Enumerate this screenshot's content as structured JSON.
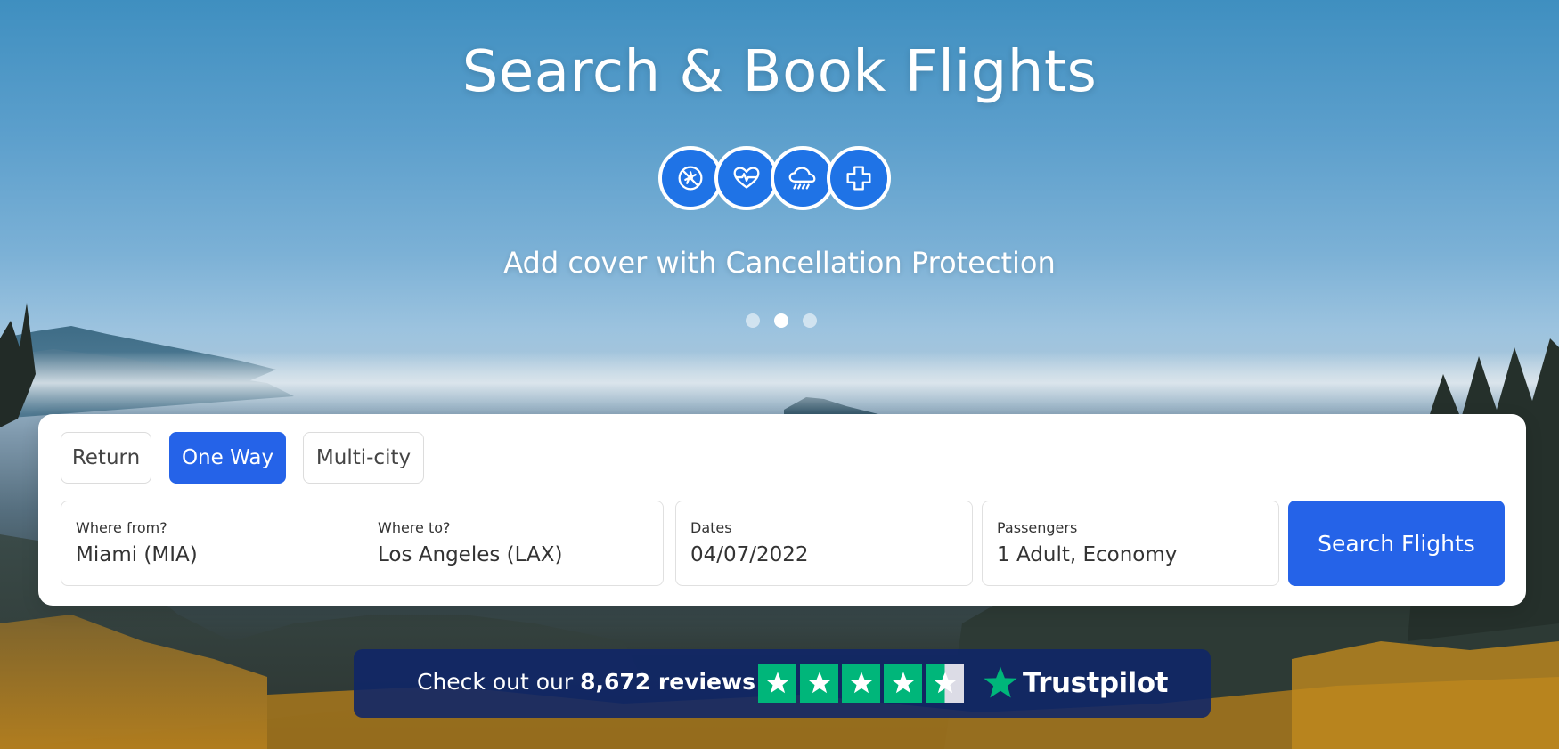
{
  "hero": {
    "title": "Search & Book Flights",
    "subtitle": "Add cover with Cancellation Protection",
    "protection_icons": [
      "no-flight-icon",
      "health-icon",
      "weather-icon",
      "medical-cross-icon"
    ],
    "carousel": {
      "slide_count": 3,
      "active_slide": 2
    }
  },
  "search": {
    "trip_types": [
      "Return",
      "One Way",
      "Multi-city"
    ],
    "active_trip_type": "One Way",
    "from": {
      "label": "Where from?",
      "value": "Miami (MIA)"
    },
    "to": {
      "label": "Where to?",
      "value": "Los Angeles (LAX)"
    },
    "dates": {
      "label": "Dates",
      "value": "04/07/2022"
    },
    "passengers": {
      "label": "Passengers",
      "value": "1 Adult, Economy"
    },
    "submit_label": "Search Flights"
  },
  "trustpilot": {
    "text_prefix": "Check out our",
    "review_count": "8,672 reviews",
    "rating_stars": 4.5,
    "brand": "Trustpilot"
  },
  "colors": {
    "primary": "#2563e8",
    "icon_blue": "#1f73e6",
    "trustpilot_green": "#00b67a",
    "trust_bar_bg": "#0f2669"
  }
}
